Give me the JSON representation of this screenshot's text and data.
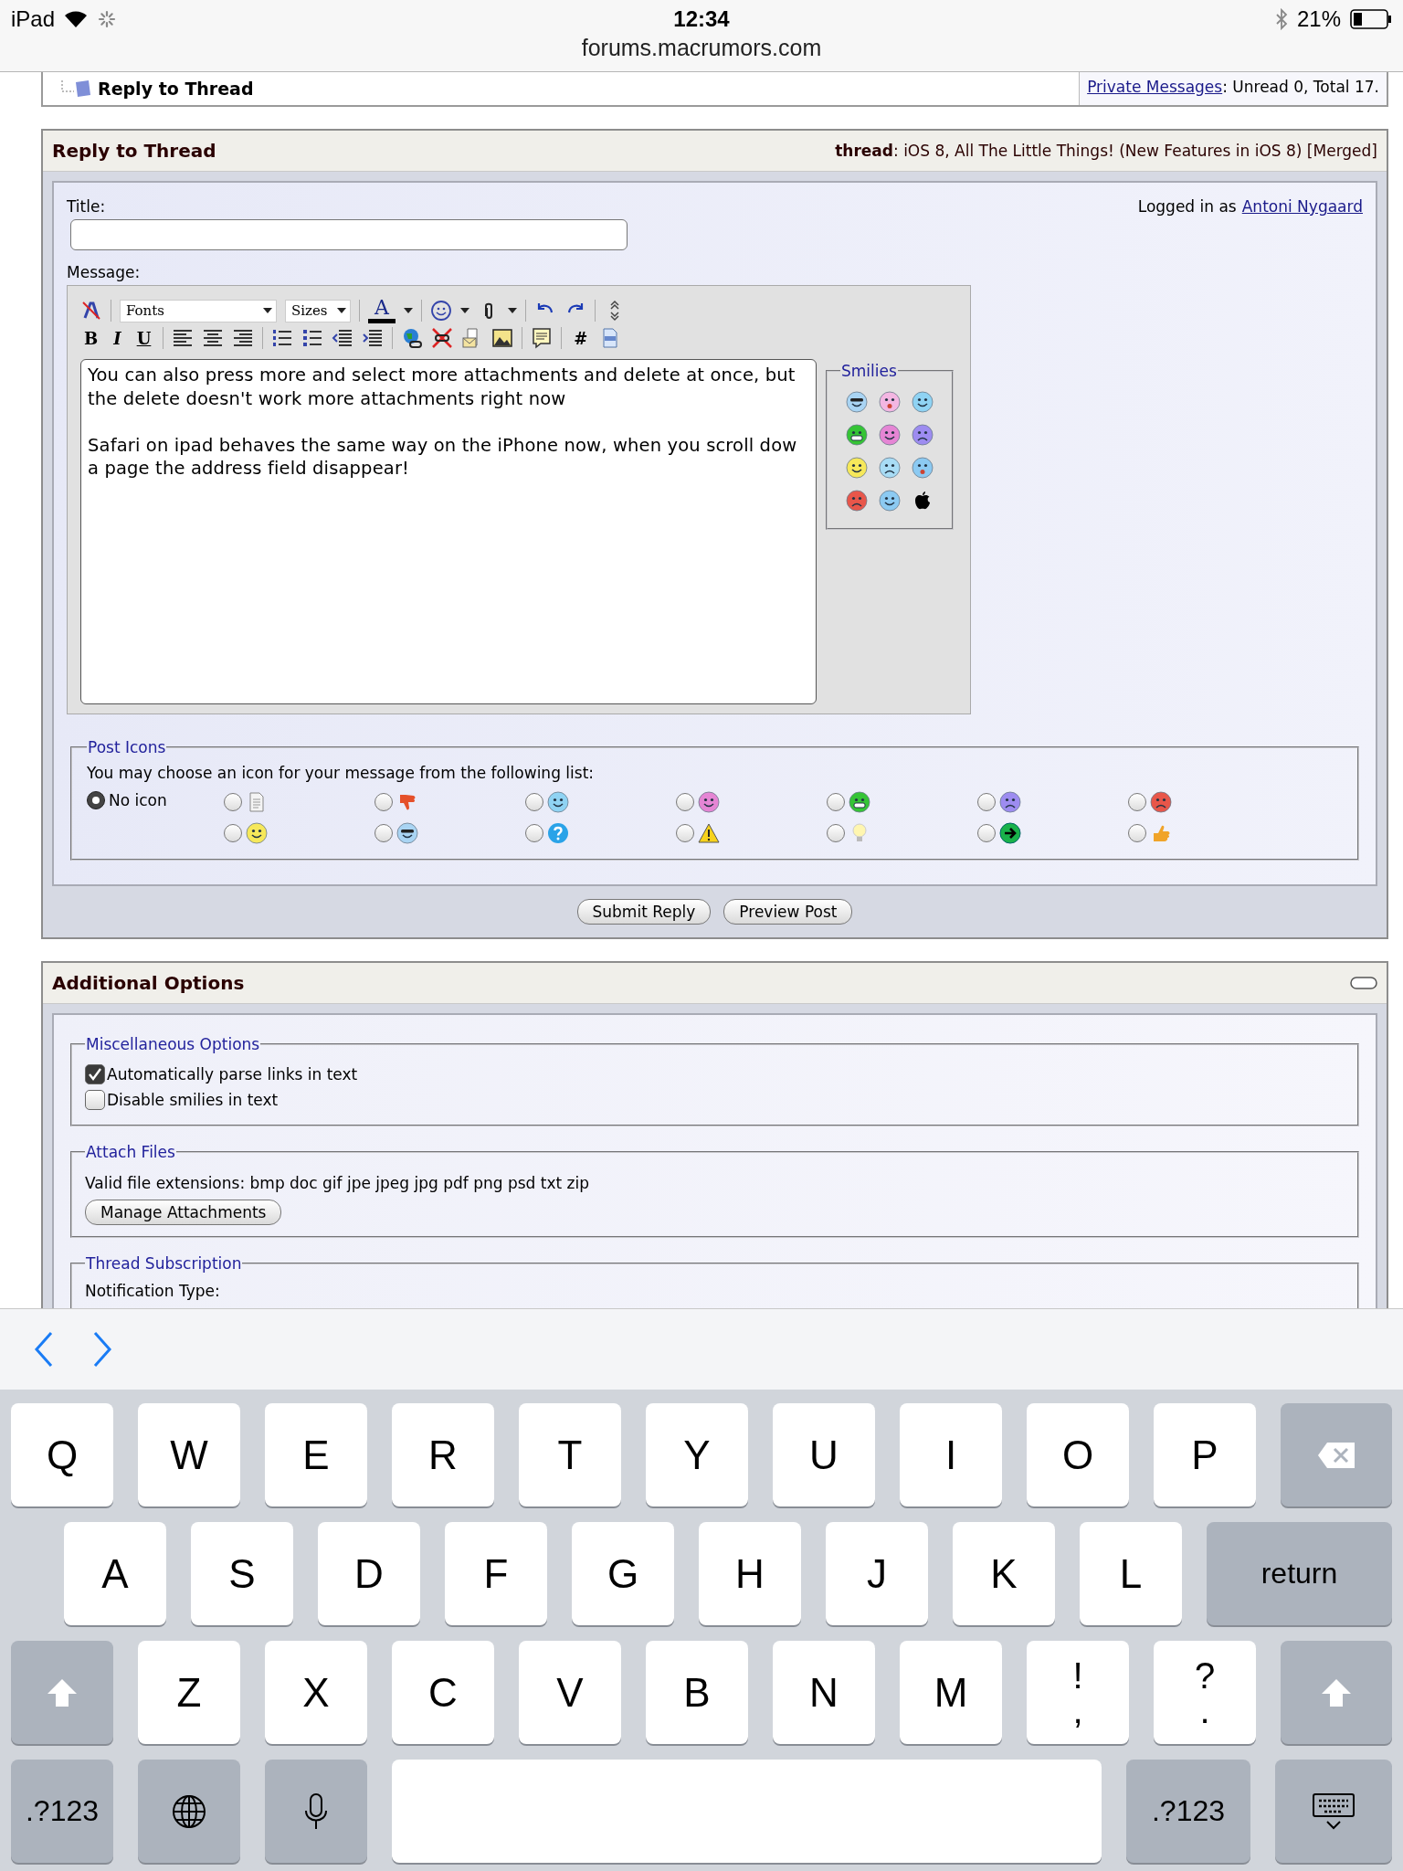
{
  "status_bar": {
    "device": "iPad",
    "time": "12:34",
    "battery": "21%",
    "url": "forums.macrumors.com"
  },
  "top_panel": {
    "title": "Reply to Thread",
    "pm_link": "Private Messages",
    "pm_text": ": Unread 0, Total 17."
  },
  "reply_panel": {
    "title": "Reply to Thread",
    "thread": "**thread**: iOS 8, All The Little Things! (New Features in iOS 8) [Merged]",
    "title_label": "Title:",
    "logged_in": "Logged in as",
    "user_link": "Antoni Nygaard",
    "message_label": "Message:",
    "toolbar": {
      "font_select": "Fonts",
      "size_select": "Sizes",
      "color_button": "A",
      "text_buttons": [
        "B",
        "I",
        "U"
      ],
      "hash_button": "#"
    },
    "message": "You can also press more and select more attachments and delete at once, but the delete doesn't work more attachments right now\n\nSafari on ipad behaves the same way on the iPhone now, when you scroll dow a page the address field disappear!",
    "smilies_legend": "Smilies",
    "post_icons": {
      "legend": "Post Icons",
      "hint": "You may choose an icon for your message from the following list:",
      "options": [
        {
          "label": "No icon",
          "selected": true
        },
        {
          "selected": false
        },
        {
          "selected": false
        },
        {
          "selected": false
        },
        {
          "selected": false
        },
        {
          "selected": false
        },
        {
          "selected": false
        },
        {
          "selected": false
        },
        {
          "selected": false
        },
        {
          "selected": false
        },
        {
          "selected": false
        },
        {
          "selected": false
        },
        {
          "selected": false
        },
        {
          "selected": false
        },
        {
          "selected": false
        }
      ]
    },
    "buttons": [
      "Submit Reply",
      "Preview Post"
    ]
  },
  "additional_options": {
    "title": "Additional Options",
    "misc": {
      "legend": "Miscellaneous Options",
      "options": [
        {
          "label": "Automatically parse links in text",
          "checked": true
        },
        {
          "label": "Disable smilies in text",
          "checked": false
        }
      ]
    },
    "attach": {
      "legend": "Attach Files",
      "text": "Valid file extensions: bmp doc gif jpe jpeg jpg pdf png psd txt zip",
      "button": "Manage Attachments"
    },
    "subscription": {
      "legend": "Thread Subscription",
      "label": "Notification Type:"
    }
  },
  "keyboard": {
    "rows": [
      {
        "keys": [
          {
            "kind": "letter",
            "label": "Q"
          },
          {
            "kind": "letter",
            "label": "W"
          },
          {
            "kind": "letter",
            "label": "E"
          },
          {
            "kind": "letter",
            "label": "R"
          },
          {
            "kind": "letter",
            "label": "T"
          },
          {
            "kind": "letter",
            "label": "Y"
          },
          {
            "kind": "letter",
            "label": "U"
          },
          {
            "kind": "letter",
            "label": "I"
          },
          {
            "kind": "letter",
            "label": "O"
          },
          {
            "kind": "letter",
            "label": "P"
          },
          {
            "kind": "backspace"
          }
        ]
      },
      {
        "keys": [
          {
            "kind": "letter",
            "label": "A"
          },
          {
            "kind": "letter",
            "label": "S"
          },
          {
            "kind": "letter",
            "label": "D"
          },
          {
            "kind": "letter",
            "label": "F"
          },
          {
            "kind": "letter",
            "label": "G"
          },
          {
            "kind": "letter",
            "label": "H"
          },
          {
            "kind": "letter",
            "label": "J"
          },
          {
            "kind": "letter",
            "label": "K"
          },
          {
            "kind": "letter",
            "label": "L"
          },
          {
            "kind": "return",
            "label": "return"
          }
        ]
      },
      {
        "keys": [
          {
            "kind": "shift"
          },
          {
            "kind": "letter",
            "label": "Z"
          },
          {
            "kind": "letter",
            "label": "X"
          },
          {
            "kind": "letter",
            "label": "C"
          },
          {
            "kind": "letter",
            "label": "V"
          },
          {
            "kind": "letter",
            "label": "B"
          },
          {
            "kind": "letter",
            "label": "N"
          },
          {
            "kind": "letter",
            "label": "M"
          },
          {
            "kind": "punct",
            "top": "!",
            "bottom": ","
          },
          {
            "kind": "punct",
            "top": "?",
            "bottom": "."
          },
          {
            "kind": "shift"
          }
        ]
      },
      {
        "keys": [
          {
            "kind": "mode",
            "label": ".?123"
          },
          {
            "kind": "globe"
          },
          {
            "kind": "mic"
          },
          {
            "kind": "space"
          },
          {
            "kind": "mode",
            "label": ".?123"
          },
          {
            "kind": "hide"
          }
        ]
      }
    ]
  }
}
